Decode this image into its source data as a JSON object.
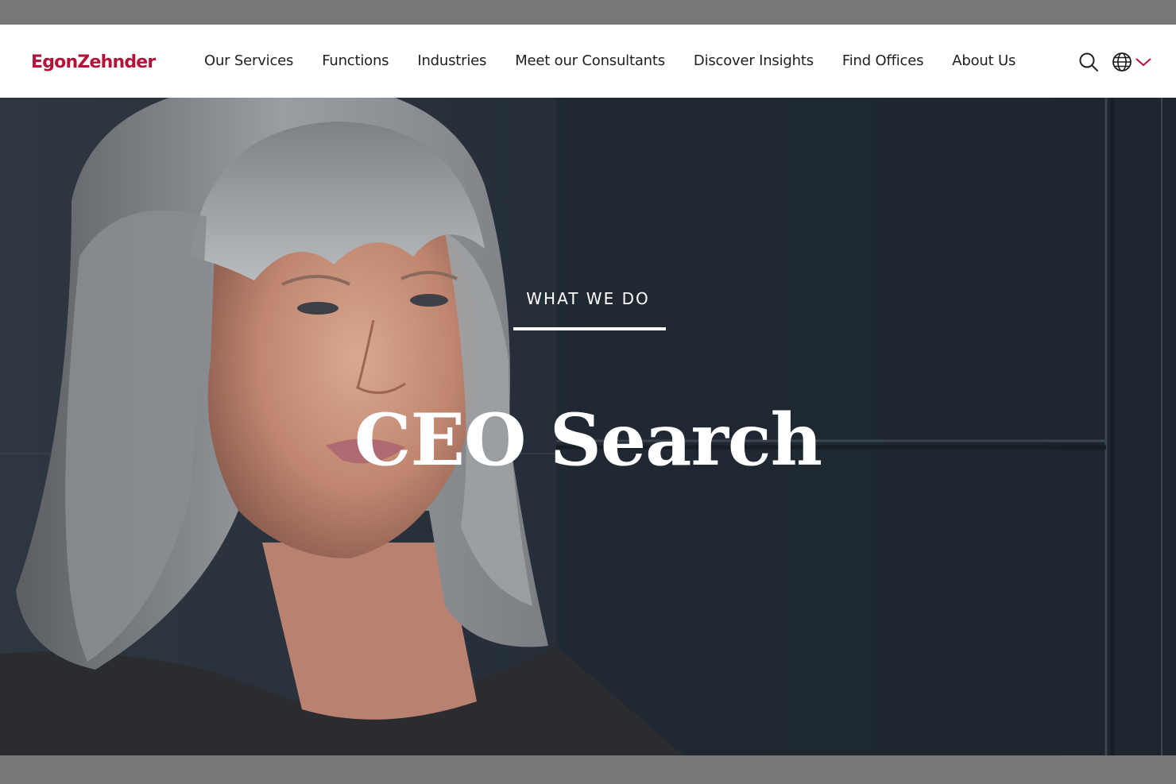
{
  "brand": {
    "logo_text": "EgonZehnder",
    "accent_color": "#b5123a"
  },
  "nav": {
    "items": [
      {
        "label": "Our Services"
      },
      {
        "label": "Functions"
      },
      {
        "label": "Industries"
      },
      {
        "label": "Meet our Consultants"
      },
      {
        "label": "Discover Insights"
      },
      {
        "label": "Find Offices"
      },
      {
        "label": "About Us"
      }
    ]
  },
  "header_icons": {
    "search": "search-icon",
    "language": "globe-icon",
    "language_toggle": "chevron-down-icon"
  },
  "hero": {
    "eyebrow": "WHAT WE DO",
    "title": "CEO Search",
    "image": "portrait of woman with grey bob hairstyle"
  }
}
